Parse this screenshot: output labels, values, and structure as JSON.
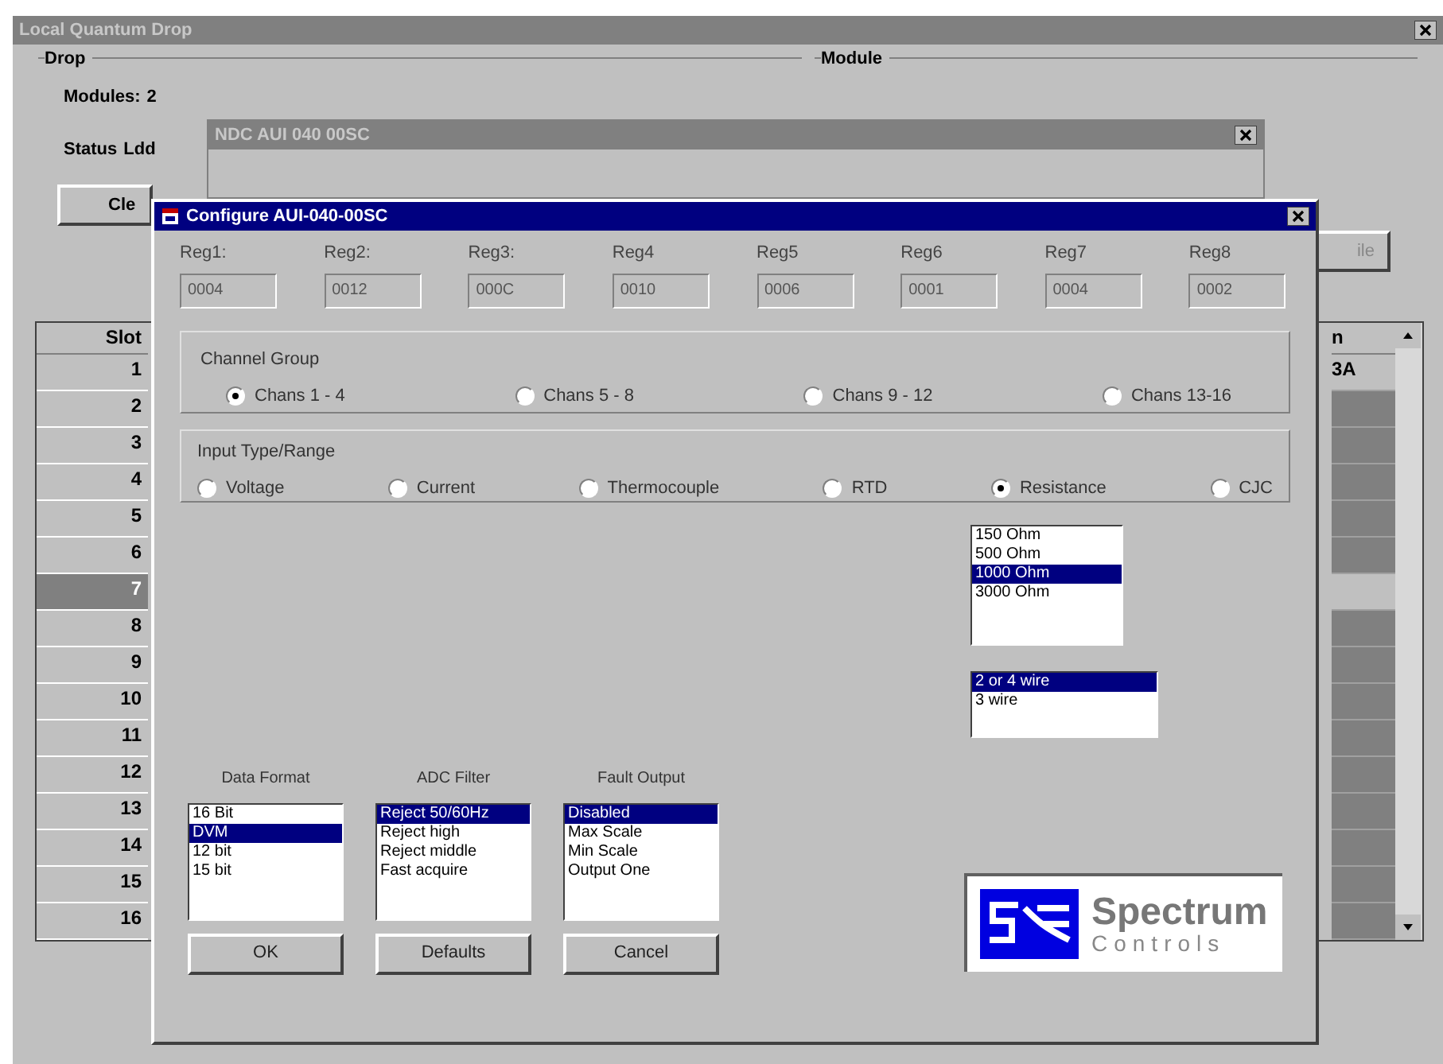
{
  "main_window": {
    "title": "Local Quantum Drop"
  },
  "drop_group": {
    "label": "Drop",
    "modules_label": "Modules:",
    "modules_value": "2",
    "status_label": "Status",
    "status_value": "Ldd"
  },
  "module_group": {
    "label": "Module"
  },
  "module_window": {
    "title": "NDC AUI 040 00SC"
  },
  "buttons": [
    "Cle",
    "ile"
  ],
  "slot_table": {
    "columns": [
      "Slot",
      "n"
    ],
    "rows": [
      {
        "slot": "1",
        "column_2": "3A",
        "selected": false
      },
      {
        "slot": "2",
        "selected": false
      },
      {
        "slot": "3",
        "selected": false
      },
      {
        "slot": "4",
        "selected": false
      },
      {
        "slot": "5",
        "selected": false
      },
      {
        "slot": "6",
        "selected": false
      },
      {
        "slot": "7",
        "selected": true
      },
      {
        "slot": "8",
        "selected": false
      },
      {
        "slot": "9",
        "selected": false
      },
      {
        "slot": "10",
        "selected": false
      },
      {
        "slot": "11",
        "selected": false
      },
      {
        "slot": "12",
        "selected": false
      },
      {
        "slot": "13",
        "selected": false
      },
      {
        "slot": "14",
        "selected": false
      },
      {
        "slot": "15",
        "selected": false
      },
      {
        "slot": "16",
        "selected": false
      }
    ]
  },
  "dialog": {
    "title": "Configure AUI-040-00SC",
    "registers": [
      {
        "label": "Reg1:",
        "value": "0004"
      },
      {
        "label": "Reg2:",
        "value": "0012"
      },
      {
        "label": "Reg3:",
        "value": "000C"
      },
      {
        "label": "Reg4",
        "value": "0010"
      },
      {
        "label": "Reg5",
        "value": "0006"
      },
      {
        "label": "Reg6",
        "value": "0001"
      },
      {
        "label": "Reg7",
        "value": "0004"
      },
      {
        "label": "Reg8",
        "value": "0002"
      }
    ],
    "channel_group": {
      "label": "Channel Group",
      "options": [
        {
          "label": "Chans 1 - 4",
          "selected": true
        },
        {
          "label": "Chans 5 - 8",
          "selected": false
        },
        {
          "label": "Chans 9 - 12",
          "selected": false
        },
        {
          "label": "Chans 13-16",
          "selected": false
        }
      ]
    },
    "input_type": {
      "label": "Input Type/Range",
      "options": [
        {
          "label": "Voltage",
          "selected": false
        },
        {
          "label": "Current",
          "selected": false
        },
        {
          "label": "Thermocouple",
          "selected": false
        },
        {
          "label": "RTD",
          "selected": false
        },
        {
          "label": "Resistance",
          "selected": true
        },
        {
          "label": "CJC",
          "selected": false
        }
      ]
    },
    "range_list": [
      {
        "label": "150 Ohm",
        "selected": false
      },
      {
        "label": "500 Ohm",
        "selected": false
      },
      {
        "label": "1000 Ohm",
        "selected": true
      },
      {
        "label": "3000 Ohm",
        "selected": false
      }
    ],
    "wire_list": [
      {
        "label": "2 or 4 wire",
        "selected": true
      },
      {
        "label": "3 wire",
        "selected": false
      }
    ],
    "lists": [
      {
        "label": "Data Format",
        "items": [
          {
            "label": "16 Bit",
            "selected": false
          },
          {
            "label": "DVM",
            "selected": true
          },
          {
            "label": "12 bit",
            "selected": false
          },
          {
            "label": "15 bit",
            "selected": false
          }
        ]
      },
      {
        "label": "ADC Filter",
        "items": [
          {
            "label": "Reject 50/60Hz",
            "selected": true
          },
          {
            "label": "Reject high",
            "selected": false
          },
          {
            "label": "Reject middle",
            "selected": false
          },
          {
            "label": "Fast acquire",
            "selected": false
          }
        ]
      },
      {
        "label": "Fault Output",
        "items": [
          {
            "label": "Disabled",
            "selected": true
          },
          {
            "label": "Max Scale",
            "selected": false
          },
          {
            "label": "Min Scale",
            "selected": false
          },
          {
            "label": "Output One",
            "selected": false
          }
        ]
      }
    ],
    "buttons": [
      "OK",
      "Defaults",
      "Cancel"
    ],
    "logo": {
      "line_1": "Spectrum",
      "line_2": "Controls"
    }
  }
}
